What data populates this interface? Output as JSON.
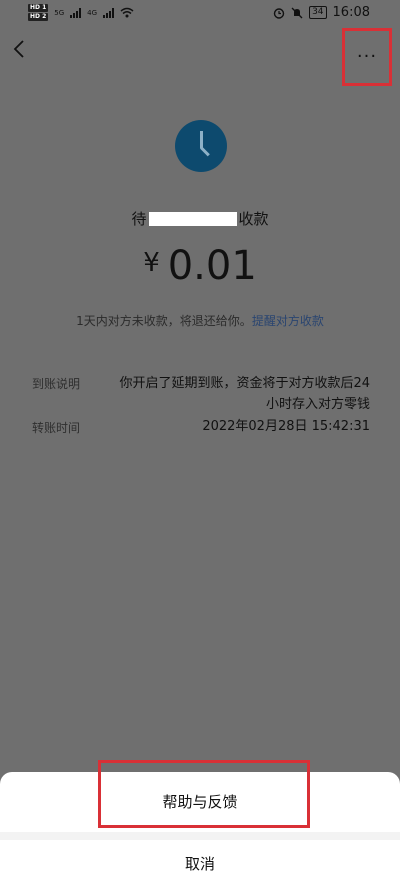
{
  "status_bar": {
    "sim1": "HD 1",
    "sim2": "HD 2",
    "network1": "5G",
    "network2": "4G",
    "battery": "34",
    "time": "16:08",
    "icons": [
      "alarm-icon",
      "mute-icon",
      "wifi-icon",
      "battery-icon"
    ]
  },
  "header": {
    "back_icon": "back-arrow-icon",
    "more_label": "···"
  },
  "transfer": {
    "status_prefix": "待",
    "status_suffix": "收款",
    "currency": "¥",
    "amount": "0.01",
    "note_text": "1天内对方未收款，将退还给你。",
    "remind_link": "提醒对方收款"
  },
  "details": {
    "arrival_label": "到账说明",
    "arrival_line1": "你开启了延期到账，资金将于对方收款后24",
    "arrival_line2": "小时存入对方零钱",
    "time_label": "转账时间",
    "time_value": "2022年02月28日 15:42:31"
  },
  "sheet": {
    "help": "帮助与反馈",
    "cancel": "取消"
  },
  "colors": {
    "overlay": "#6f6f6f",
    "clock": "#0d4a6e",
    "highlight": "#d93036",
    "link": "#2a4570"
  }
}
